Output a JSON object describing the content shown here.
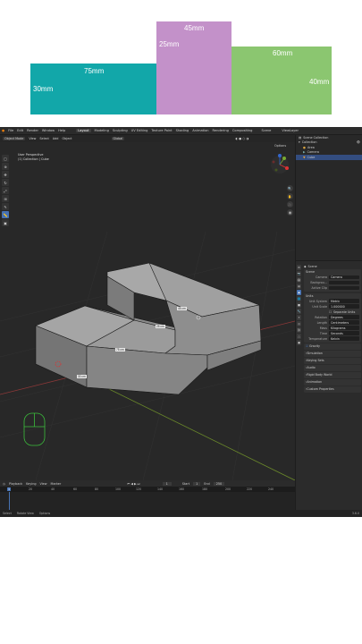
{
  "diagram": {
    "blocks": [
      {
        "width_label": "75mm",
        "height_label": "30mm",
        "color": "#12a7a9"
      },
      {
        "width_label": "45mm",
        "height_label": "25mm",
        "color": "#c391c9"
      },
      {
        "width_label": "60mm",
        "height_label": "40mm",
        "color": "#8bc670"
      }
    ]
  },
  "topbar": {
    "menus": [
      "File",
      "Edit",
      "Render",
      "Window",
      "Help"
    ],
    "workspaces": [
      "Layout",
      "Modeling",
      "Sculpting",
      "UV Editing",
      "Texture Paint",
      "Shading",
      "Animation",
      "Rendering",
      "Compositing"
    ],
    "scene": "Scene",
    "view_layer": "ViewLayer"
  },
  "header": {
    "mode": "Object Mode",
    "menus": [
      "View",
      "Select",
      "Add",
      "Object"
    ],
    "transform": "Global",
    "options": "Options"
  },
  "viewport": {
    "perspective": "User Perspective",
    "collection": "(1) Collection | Cube",
    "labels": [
      "45 cm",
      "25 cm",
      "75 cm",
      "30 cm"
    ],
    "gizmo": [
      "X",
      "Y",
      "Z"
    ]
  },
  "tools": [
    "select",
    "cursor",
    "move",
    "rotate",
    "scale",
    "transform",
    "annotate",
    "measure",
    "add-cube"
  ],
  "outliner": {
    "title": "Scene Collection",
    "items": [
      "Collection",
      "Area",
      "Camera",
      "Cube"
    ]
  },
  "properties": {
    "scene_title": "Scene",
    "scene_panel": "Scene",
    "camera_label": "Camera",
    "camera_value": "Camera",
    "background_label": "Backgrou...",
    "active_clip_label": "Active Clip",
    "active_clip_value": "",
    "units_panel": "Units",
    "unit_system_label": "Unit System",
    "unit_system_value": "Metric",
    "unit_scale_label": "Unit Scale",
    "unit_scale_value": "1.000000",
    "separate_units": "Separate Units",
    "rotation_label": "Rotation",
    "rotation_value": "Degrees",
    "length_label": "Length",
    "length_value": "Centimeters",
    "mass_label": "Mass",
    "mass_value": "Kilograms",
    "time_label": "Time",
    "time_value": "Seconds",
    "temperature_label": "Temperature",
    "temperature_value": "Kelvin",
    "collapsed": [
      "Gravity",
      "Simulation",
      "Keying Sets",
      "Audio",
      "Rigid Body World",
      "Animation",
      "Custom Properties"
    ]
  },
  "timeline": {
    "menus": [
      "Playback",
      "Keying",
      "View",
      "Marker"
    ],
    "current_frame": "1",
    "start_label": "Start",
    "start_value": "1",
    "end_label": "End",
    "end_value": "250",
    "ticks": [
      "1",
      "20",
      "40",
      "60",
      "80",
      "100",
      "120",
      "140",
      "160",
      "180",
      "200",
      "220",
      "240"
    ]
  },
  "status": {
    "items": [
      "Select",
      "Rotate View",
      "Options"
    ],
    "version": "3.6.0"
  }
}
